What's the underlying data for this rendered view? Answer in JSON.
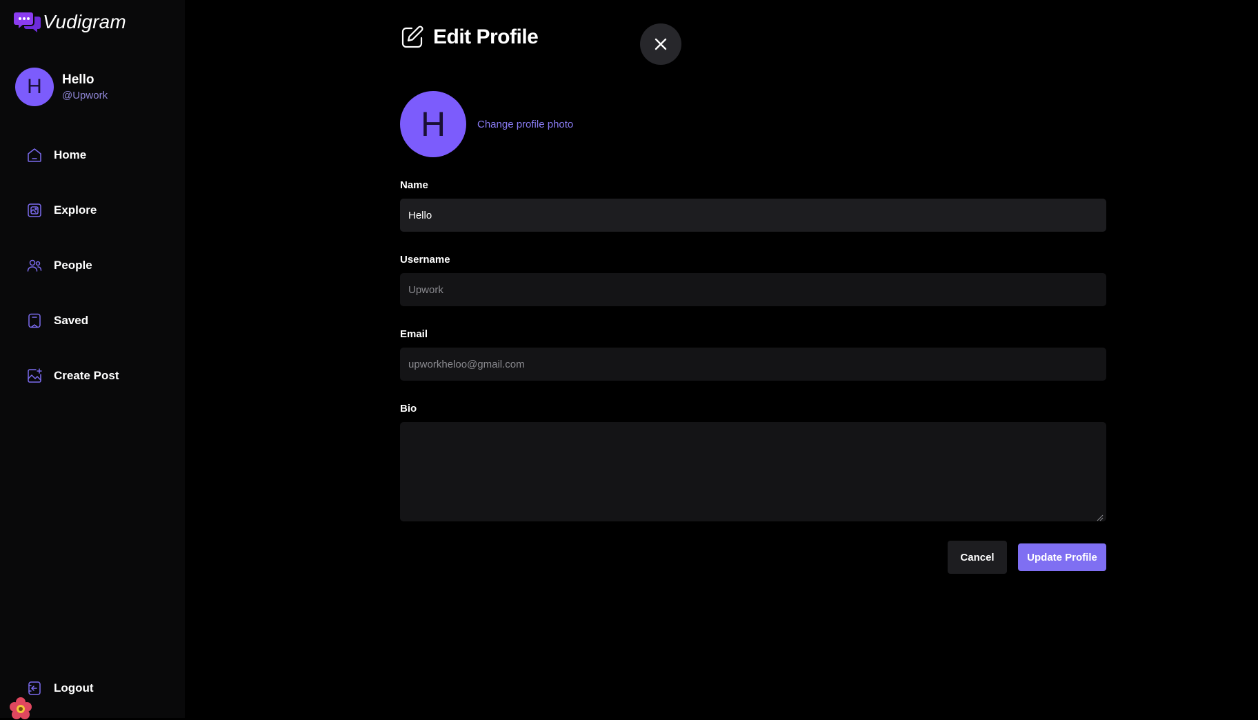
{
  "app": {
    "name": "Vudigram",
    "accent_color": "#7c5cfc"
  },
  "user": {
    "initial": "H",
    "name": "Hello",
    "handle": "@Upwork"
  },
  "sidebar": {
    "items": [
      {
        "label": "Home",
        "icon": "home-icon"
      },
      {
        "label": "Explore",
        "icon": "explore-icon"
      },
      {
        "label": "People",
        "icon": "people-icon"
      },
      {
        "label": "Saved",
        "icon": "bookmark-icon"
      },
      {
        "label": "Create Post",
        "icon": "create-post-icon"
      }
    ],
    "logout_label": "Logout"
  },
  "edit_profile": {
    "title": "Edit Profile",
    "change_photo_label": "Change profile photo",
    "avatar_initial": "H",
    "fields": {
      "name": {
        "label": "Name",
        "value": "Hello"
      },
      "username": {
        "label": "Username",
        "value": "Upwork"
      },
      "email": {
        "label": "Email",
        "value": "upworkheloo@gmail.com"
      },
      "bio": {
        "label": "Bio",
        "value": ""
      }
    },
    "cancel_label": "Cancel",
    "update_label": "Update Profile"
  }
}
